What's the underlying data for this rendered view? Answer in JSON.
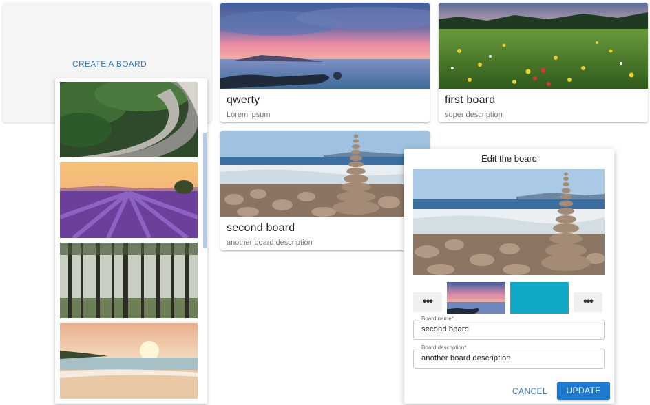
{
  "create": {
    "label": "CREATE A BOARD"
  },
  "boards": [
    {
      "title": "qwerty",
      "description": "Lorem ipsum",
      "image": "sunset-sea"
    },
    {
      "title": "first board",
      "description": "super description",
      "image": "flower-meadow"
    },
    {
      "title": "second board",
      "description": "another board description",
      "image": "stone-stack-beach"
    }
  ],
  "picker": {
    "images": [
      "forest-road",
      "lavender-field",
      "pine-forest",
      "beach-sunrise"
    ]
  },
  "dialog": {
    "title": "Edit the board",
    "preview_image": "stone-stack-beach",
    "options": [
      {
        "type": "more",
        "label": "•••"
      },
      {
        "type": "image",
        "image": "sunset-sea"
      },
      {
        "type": "color",
        "color": "#12a8c8"
      },
      {
        "type": "more",
        "label": "•••"
      }
    ],
    "name_field": {
      "label": "Board name*",
      "value": "second board"
    },
    "description_field": {
      "label": "Board description*",
      "value": "another board description"
    },
    "cancel_label": "CANCEL",
    "update_label": "UPDATE"
  },
  "colors": {
    "accent": "#1e7ad1",
    "link": "#3a7ab8",
    "scrollbar": "#a9c8f3"
  }
}
